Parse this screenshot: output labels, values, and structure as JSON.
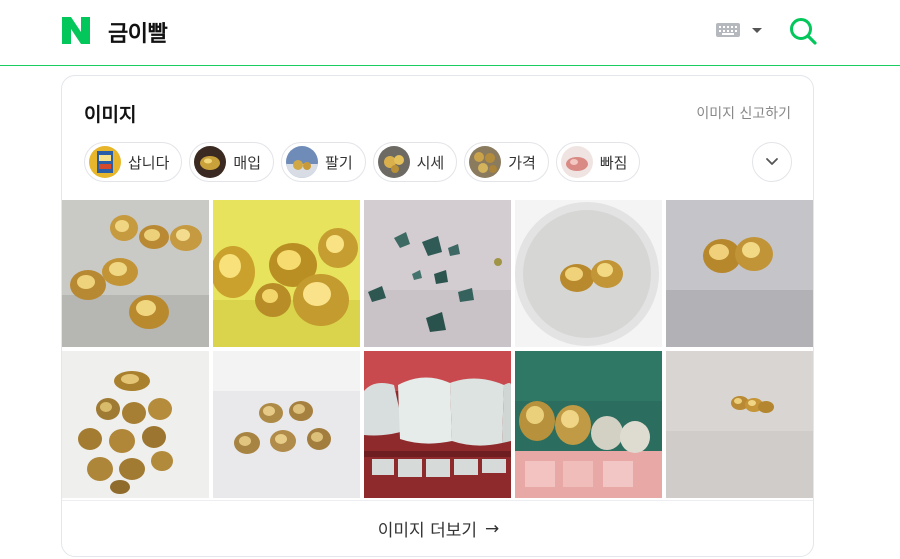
{
  "header": {
    "query": "금이빨",
    "brand_color": "#03c75a",
    "logo_icon": "naver-n-logo",
    "keyboard_icon": "keyboard-icon",
    "search_icon": "search-icon"
  },
  "image_section": {
    "title": "이미지",
    "report_label": "이미지 신고하기",
    "chips": [
      {
        "label": "삽니다"
      },
      {
        "label": "매입"
      },
      {
        "label": "팔기"
      },
      {
        "label": "시세"
      },
      {
        "label": "가격"
      },
      {
        "label": "빠짐"
      }
    ],
    "more_chips_icon": "chevron-down-icon",
    "more_label": "이미지 더보기",
    "more_arrow": "→"
  }
}
